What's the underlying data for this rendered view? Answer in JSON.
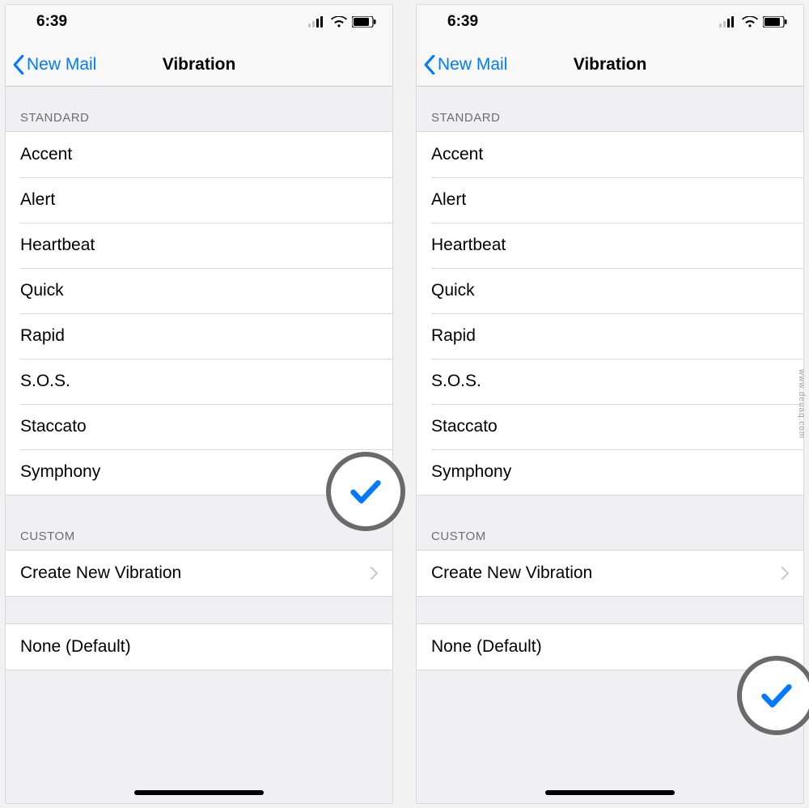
{
  "status": {
    "time": "6:39"
  },
  "nav": {
    "back_label": "New Mail",
    "title": "Vibration"
  },
  "sections": {
    "standard_header": "STANDARD",
    "custom_header": "CUSTOM",
    "standard_items": [
      {
        "label": "Accent"
      },
      {
        "label": "Alert"
      },
      {
        "label": "Heartbeat"
      },
      {
        "label": "Quick"
      },
      {
        "label": "Rapid"
      },
      {
        "label": "S.O.S."
      },
      {
        "label": "Staccato"
      },
      {
        "label": "Symphony"
      }
    ],
    "create_label": "Create New Vibration",
    "none_label": "None (Default)"
  },
  "screens": {
    "left": {
      "selected": "Symphony"
    },
    "right": {
      "selected": "None (Default)"
    }
  },
  "watermark": "www.deuaq.com"
}
